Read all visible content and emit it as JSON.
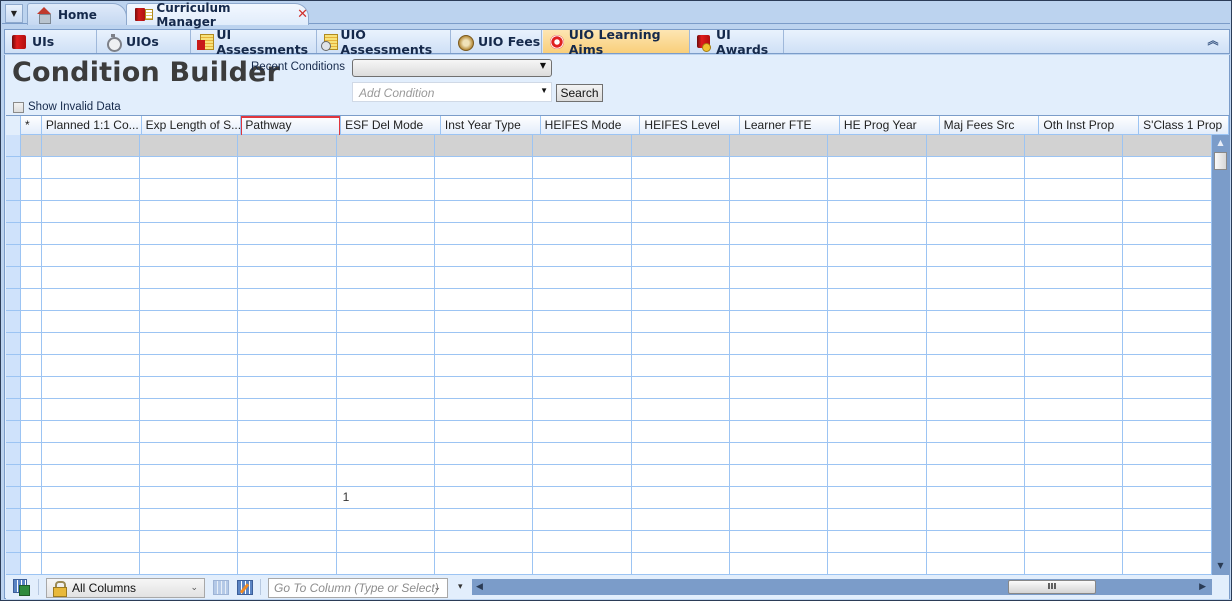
{
  "doc_tabs": {
    "dropdown_icon": "triangle-down",
    "items": [
      {
        "label": "Home",
        "icon": "home-icon"
      },
      {
        "label": "Curriculum Manager",
        "icon": "book-icon",
        "close": "✕",
        "active": true
      }
    ]
  },
  "module_tabs": {
    "items": [
      {
        "label": "UIs",
        "icon": "book-icon"
      },
      {
        "label": "UIOs",
        "icon": "stopwatch-icon"
      },
      {
        "label": "UI Assessments",
        "icon": "assessment-icon"
      },
      {
        "label": "UIO Assessments",
        "icon": "uio-assessment-icon"
      },
      {
        "label": "UIO Fees",
        "icon": "fees-icon"
      },
      {
        "label": "UIO Learning Aims",
        "icon": "target-icon",
        "active": true
      },
      {
        "label": "UI Awards",
        "icon": "award-icon"
      }
    ],
    "collapse_icon": "⌃"
  },
  "condition_builder": {
    "title": "Condition Builder",
    "recent_conditions_label": "Recent Conditions",
    "recent_conditions_value": "",
    "add_condition_placeholder": "Add Condition",
    "search_label": "Search",
    "show_invalid_label": "Show Invalid Data",
    "show_invalid_checked": false
  },
  "grid": {
    "columns": [
      {
        "label": "*"
      },
      {
        "label": "Planned 1:1 Co..."
      },
      {
        "label": "Exp Length of S..."
      },
      {
        "label": "Pathway",
        "selected": true
      },
      {
        "label": "ESF Del Mode"
      },
      {
        "label": "Inst Year Type"
      },
      {
        "label": "HEIFES Mode"
      },
      {
        "label": "HEIFES Level"
      },
      {
        "label": "Learner FTE"
      },
      {
        "label": "HE Prog Year"
      },
      {
        "label": "Maj Fees Src"
      },
      {
        "label": "Oth Inst Prop"
      },
      {
        "label": "S'Class 1 Prop"
      }
    ],
    "rows": [
      [
        "",
        "",
        "",
        "",
        "",
        "",
        "",
        "",
        "",
        "",
        "",
        ""
      ],
      [
        "",
        "",
        "",
        "",
        "",
        "",
        "",
        "",
        "",
        "",
        "",
        ""
      ],
      [
        "",
        "",
        "",
        "",
        "",
        "",
        "",
        "",
        "",
        "",
        "",
        ""
      ],
      [
        "",
        "",
        "",
        "",
        "",
        "",
        "",
        "",
        "",
        "",
        "",
        ""
      ],
      [
        "",
        "",
        "",
        "",
        "",
        "",
        "",
        "",
        "",
        "",
        "",
        ""
      ],
      [
        "",
        "",
        "",
        "",
        "",
        "",
        "",
        "",
        "",
        "",
        "",
        ""
      ],
      [
        "",
        "",
        "",
        "",
        "",
        "",
        "",
        "",
        "",
        "",
        "",
        ""
      ],
      [
        "",
        "",
        "",
        "",
        "",
        "",
        "",
        "",
        "",
        "",
        "",
        ""
      ],
      [
        "",
        "",
        "",
        "",
        "",
        "",
        "",
        "",
        "",
        "",
        "",
        ""
      ],
      [
        "",
        "",
        "",
        "",
        "",
        "",
        "",
        "",
        "",
        "",
        "",
        ""
      ],
      [
        "",
        "",
        "",
        "",
        "",
        "",
        "",
        "",
        "",
        "",
        "",
        ""
      ],
      [
        "",
        "",
        "",
        "",
        "",
        "",
        "",
        "",
        "",
        "",
        "",
        ""
      ],
      [
        "",
        "",
        "",
        "",
        "",
        "",
        "",
        "",
        "",
        "",
        "",
        ""
      ],
      [
        "",
        "",
        "",
        "",
        "",
        "",
        "",
        "",
        "",
        "",
        "",
        ""
      ],
      [
        "",
        "",
        "",
        "",
        "",
        "",
        "",
        "",
        "",
        "",
        "",
        ""
      ],
      [
        "",
        "",
        "",
        "",
        "",
        "",
        "",
        "",
        "",
        "",
        "",
        ""
      ],
      [
        "",
        "",
        "",
        "1",
        "",
        "",
        "",
        "",
        "",
        "",
        "",
        ""
      ],
      [
        "",
        "",
        "",
        "",
        "",
        "",
        "",
        "",
        "",
        "",
        "",
        ""
      ],
      [
        "",
        "",
        "",
        "",
        "",
        "",
        "",
        "",
        "",
        "",
        "",
        ""
      ],
      [
        "",
        "",
        "",
        "",
        "",
        "",
        "",
        "",
        "",
        "",
        "",
        ""
      ]
    ],
    "highlighted_row": 0
  },
  "bottom_toolbar": {
    "column_set_value": "All Columns",
    "goto_column_placeholder": "Go To Column (Type or Select)",
    "hscroll_grip": "III"
  }
}
